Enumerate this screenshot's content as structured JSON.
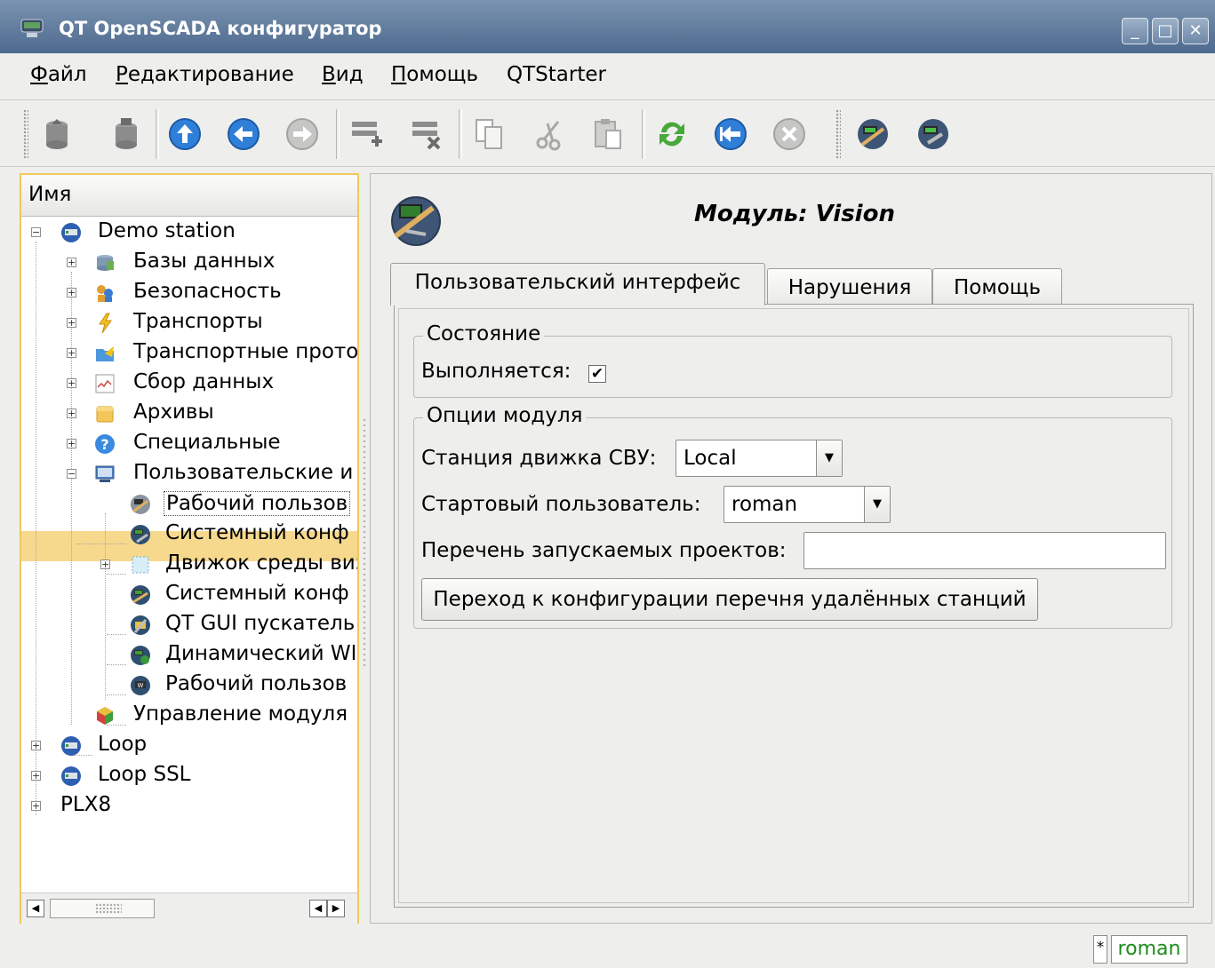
{
  "window": {
    "title": "QT OpenSCADA конфигуратор"
  },
  "menu": [
    {
      "label": "Файл",
      "accel": "Ф",
      "rest": "айл"
    },
    {
      "label": "Редактирование",
      "accel": "Р",
      "rest": "едактирование"
    },
    {
      "label": "Вид",
      "accel": "В",
      "rest": "ид"
    },
    {
      "label": "Помощь",
      "accel": "П",
      "rest": "омощь"
    },
    {
      "label": "QTStarter",
      "accel": "",
      "rest": "QTStarter"
    }
  ],
  "toolbar": {
    "icons": [
      "db-load-icon",
      "db-save-icon",
      "up-icon",
      "back-icon",
      "forward-icon",
      "add-item-icon",
      "delete-item-icon",
      "copy-icon",
      "cut-icon",
      "paste-icon",
      "refresh-icon",
      "start-icon",
      "stop-icon",
      "vision-runtime-icon",
      "vision-dev-icon"
    ]
  },
  "tree": {
    "header": "Имя",
    "items": [
      {
        "label": "Demo station",
        "level": 0,
        "icon": "station-icon",
        "expander": "−"
      },
      {
        "label": "Базы данных",
        "level": 1,
        "icon": "databases-icon",
        "expander": "+"
      },
      {
        "label": "Безопасность",
        "level": 1,
        "icon": "security-icon",
        "expander": "+"
      },
      {
        "label": "Транспорты",
        "level": 1,
        "icon": "transports-icon",
        "expander": "+"
      },
      {
        "label": "Транспортные прото",
        "level": 1,
        "icon": "protocols-icon",
        "expander": "+"
      },
      {
        "label": "Сбор данных",
        "level": 1,
        "icon": "daq-icon",
        "expander": "+"
      },
      {
        "label": "Архивы",
        "level": 1,
        "icon": "archives-icon",
        "expander": "+"
      },
      {
        "label": "Специальные",
        "level": 1,
        "icon": "special-icon",
        "expander": "+"
      },
      {
        "label": "Пользовательские и",
        "level": 1,
        "icon": "ui-icon",
        "expander": "−"
      },
      {
        "label": "Рабочий пользов",
        "level": 2,
        "icon": "vision-module-icon",
        "expander": "",
        "selected": true
      },
      {
        "label": "Системный конф",
        "level": 2,
        "icon": "config-module-icon",
        "expander": ""
      },
      {
        "label": "Движок среды виз",
        "level": 2,
        "icon": "vca-engine-icon",
        "expander": "+"
      },
      {
        "label": "Системный конф",
        "level": 2,
        "icon": "config-module-icon",
        "expander": ""
      },
      {
        "label": "QT GUI пускатель",
        "level": 2,
        "icon": "qtstarter-icon",
        "expander": ""
      },
      {
        "label": "Динамический WI",
        "level": 2,
        "icon": "web-module-icon",
        "expander": ""
      },
      {
        "label": "Рабочий пользов",
        "level": 2,
        "icon": "web-user-icon",
        "expander": ""
      },
      {
        "label": "Управление модуля",
        "level": 1,
        "icon": "modules-icon",
        "expander": ""
      },
      {
        "label": "Loop",
        "level": 0,
        "icon": "station-icon",
        "expander": "+"
      },
      {
        "label": "Loop SSL",
        "level": 0,
        "icon": "station-icon",
        "expander": "+"
      },
      {
        "label": "PLX8",
        "level": 0,
        "icon": "",
        "expander": "+"
      }
    ]
  },
  "module": {
    "title": "Модуль: Vision",
    "tabs": [
      "Пользовательский интерфейс",
      "Нарушения",
      "Помощь"
    ],
    "active_tab": 0,
    "state_group": "Состояние",
    "running_label": "Выполняется:",
    "running_checked": true,
    "options_group": "Опции модуля",
    "engine_station_label": "Станция движка СВУ:",
    "engine_station_value": "Local",
    "start_user_label": "Стартовый пользователь:",
    "start_user_value": "roman",
    "projects_label": "Перечень запускаемых проектов:",
    "projects_value": "",
    "remote_button": "Переход к конфигурации перечня удалённых станций"
  },
  "status": {
    "modified": "*",
    "user": "roman"
  },
  "colors": {
    "selection": "#f7d98e",
    "titlebar": "#5b7699",
    "user_text": "#1e8c1e"
  }
}
